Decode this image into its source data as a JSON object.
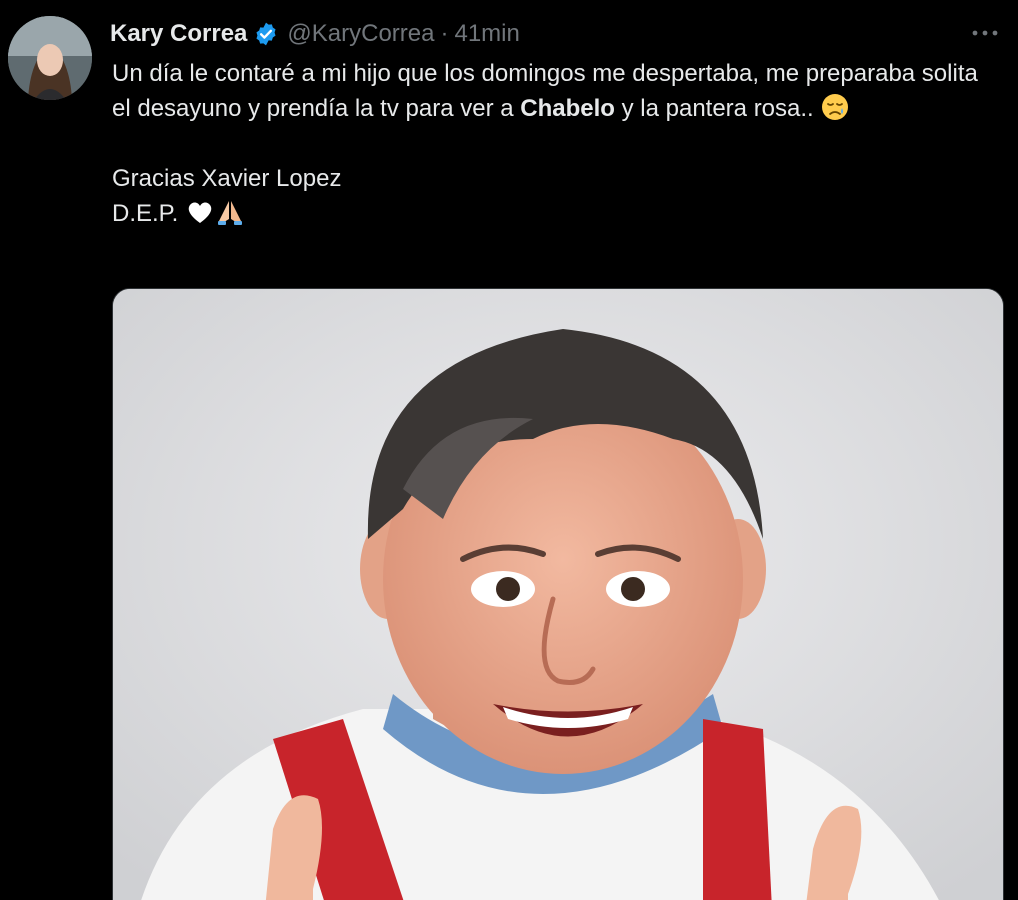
{
  "tweet": {
    "author": {
      "name": "Kary Correa",
      "handle": "@KaryCorrea",
      "verified": true
    },
    "separator": "·",
    "time": "41min",
    "more_label": "•••",
    "text": {
      "line1": "Un día le contaré a mi hijo que los domingos me despertaba, me preparaba solita el desayuno y prendía la tv para ver a ",
      "bold": "Chabelo",
      "line1_end": " y la pantera rosa.. ",
      "line2": "Gracias Xavier Lopez",
      "line3": "D.E.P. "
    },
    "emojis": [
      "sad-relieved-face-icon",
      "white-heart-icon",
      "folded-hands-icon"
    ],
    "media": {
      "kind": "photo",
      "subject": "man-in-white-shirt-red-suspenders"
    }
  },
  "colors": {
    "background": "#000000",
    "text": "#e7e9ea",
    "secondary": "#71767b",
    "verified": "#1d9bf0"
  }
}
